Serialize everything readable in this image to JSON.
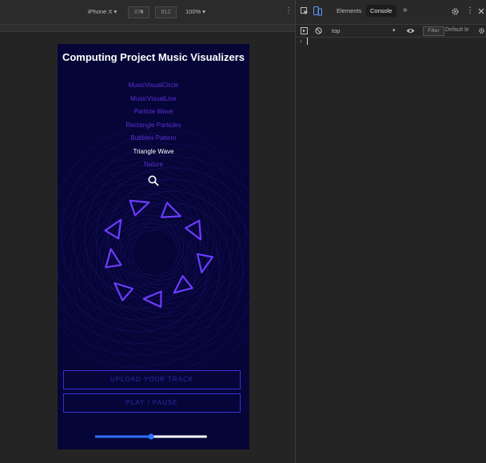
{
  "device_toolbar": {
    "device": "iPhone X ▾",
    "width": "375",
    "height": "812",
    "dim_separator": "×",
    "zoom": "100% ▾",
    "more": "⋮"
  },
  "app": {
    "title": "Computing Project Music Visualizers",
    "menu": [
      {
        "label": "MusicVisualCircle",
        "active": false
      },
      {
        "label": "MusicVisualLine",
        "active": false
      },
      {
        "label": "Particle Wave",
        "active": false
      },
      {
        "label": "Rectangle Particles",
        "active": false
      },
      {
        "label": "Bubbles Pattern",
        "active": false
      },
      {
        "label": "Triangle Wave",
        "active": true
      },
      {
        "label": "Nature",
        "active": false
      }
    ],
    "search_icon": "search-icon",
    "upload_label": "UPLOAD YOUR TRACK",
    "play_label": "PLAY / PAUSE",
    "volume": 0.5
  },
  "devtools": {
    "tabs": [
      "Elements",
      "Console"
    ],
    "active_tab": "Console",
    "more_tabs": "»",
    "context": "top",
    "context_arrow": "▾",
    "filter_placeholder": "Filter",
    "levels": "Default lе",
    "prompt": "›"
  },
  "colors": {
    "phone_bg": "#050537",
    "accent": "#5d2fd6",
    "triangle": "#6a3cff",
    "slider": "#2f72ff"
  }
}
